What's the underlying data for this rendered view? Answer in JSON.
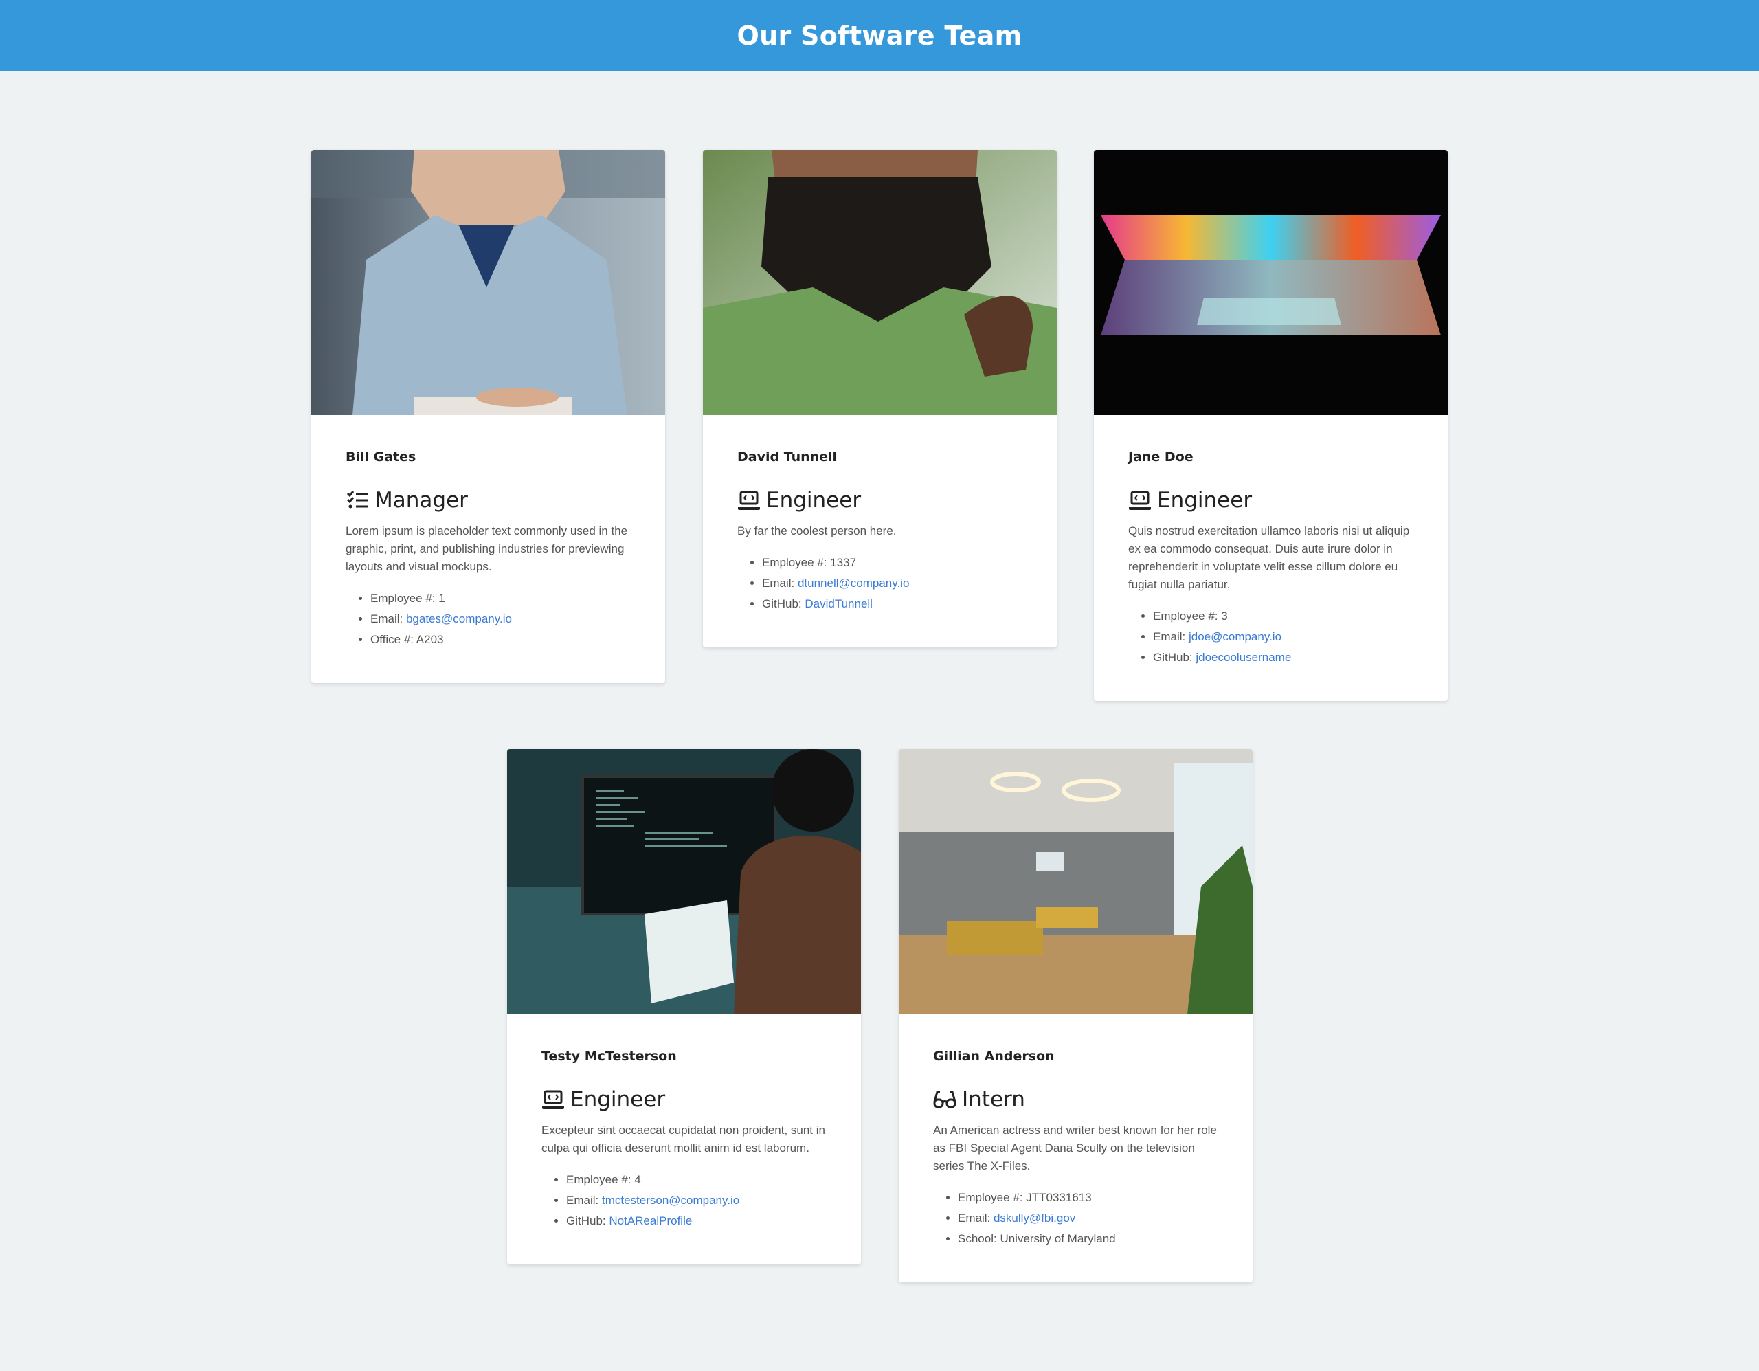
{
  "header": {
    "title": "Our Software Team"
  },
  "colors": {
    "header": "#3498db",
    "background": "#eef2f3",
    "link": "#3a7bd5"
  },
  "cards": [
    {
      "name": "Bill Gates",
      "role": "Manager",
      "role_icon": "tasks-icon",
      "description": "Lorem ipsum is placeholder text commonly used in the graphic, print, and publishing industries for previewing layouts and visual mockups.",
      "employee_label": "Employee #: ",
      "employee_value": "1",
      "email_label": "Email: ",
      "email_value": "bgates@company.io",
      "extra_label": "Office #: ",
      "extra_value": "A203"
    },
    {
      "name": "David Tunnell",
      "role": "Engineer",
      "role_icon": "laptop-code-icon",
      "description": "By far the coolest person here.",
      "employee_label": "Employee #: ",
      "employee_value": "1337",
      "email_label": "Email: ",
      "email_value": "dtunnell@company.io",
      "extra_label": "GitHub: ",
      "extra_value": "DavidTunnell"
    },
    {
      "name": "Jane Doe",
      "role": "Engineer",
      "role_icon": "laptop-code-icon",
      "description": "Quis nostrud exercitation ullamco laboris nisi ut aliquip ex ea commodo consequat. Duis aute irure dolor in reprehenderit in voluptate velit esse cillum dolore eu fugiat nulla pariatur.",
      "employee_label": "Employee #: ",
      "employee_value": "3",
      "email_label": "Email: ",
      "email_value": "jdoe@company.io",
      "extra_label": "GitHub: ",
      "extra_value": "jdoecoolusername"
    },
    {
      "name": "Testy McTesterson",
      "role": "Engineer",
      "role_icon": "laptop-code-icon",
      "description": "Excepteur sint occaecat cupidatat non proident, sunt in culpa qui officia deserunt mollit anim id est laborum.",
      "employee_label": "Employee #: ",
      "employee_value": "4",
      "email_label": "Email: ",
      "email_value": "tmctesterson@company.io",
      "extra_label": "GitHub: ",
      "extra_value": "NotARealProfile"
    },
    {
      "name": "Gillian Anderson",
      "role": "Intern",
      "role_icon": "glasses-icon",
      "description": "An American actress and writer best known for her role as FBI Special Agent Dana Scully on the television series The X-Files.",
      "employee_label": "Employee #: ",
      "employee_value": "JTT0331613",
      "email_label": "Email: ",
      "email_value": "dskully@fbi.gov",
      "extra_label": "School: ",
      "extra_value": "University of Maryland"
    }
  ]
}
